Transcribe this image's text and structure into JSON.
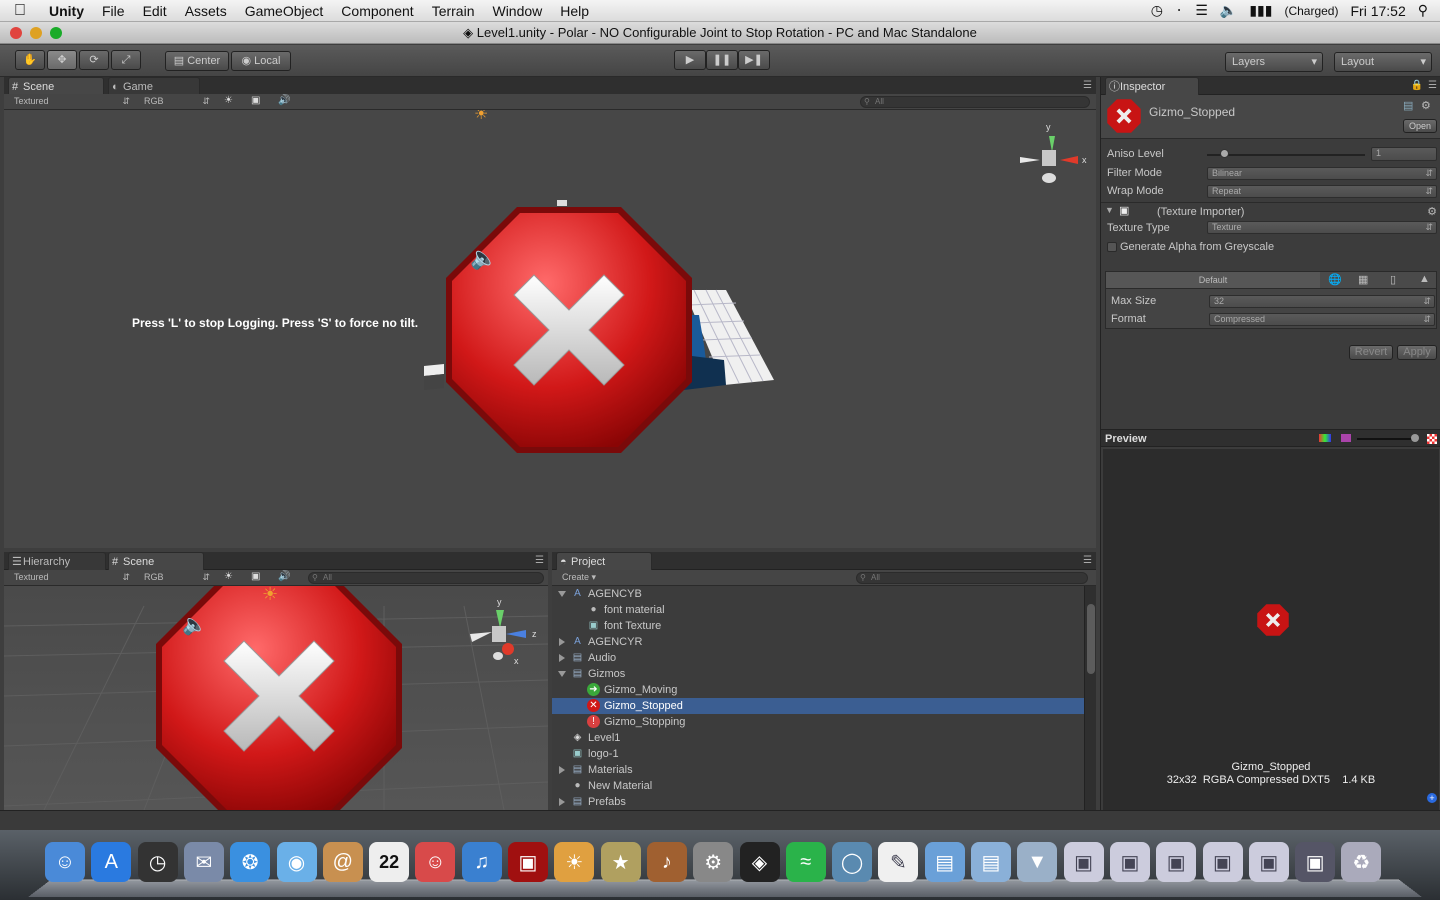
{
  "menubar": {
    "app": "Unity",
    "items": [
      "File",
      "Edit",
      "Assets",
      "GameObject",
      "Component",
      "Terrain",
      "Window",
      "Help"
    ],
    "battery": "(Charged)",
    "clock": "Fri 17:52"
  },
  "window": {
    "title": "Level1.unity - Polar - NO Configurable Joint to Stop Rotation - PC and Mac Standalone"
  },
  "toolbar": {
    "center_label": "Center",
    "local_label": "Local",
    "layers_label": "Layers",
    "layout_label": "Layout"
  },
  "scene_panel": {
    "tabs": [
      "Scene",
      "Game"
    ],
    "render_mode": "Textured",
    "color_mode": "RGB",
    "search_placeholder": "All",
    "overlay_text": "Press 'L' to stop Logging. Press 'S' to force no tilt."
  },
  "hierarchy_panel": {
    "tabs": [
      "Hierarchy",
      "Scene"
    ],
    "render_mode": "Textured",
    "color_mode": "RGB",
    "search_placeholder": "All"
  },
  "project_panel": {
    "tab": "Project",
    "create_label": "Create",
    "search_placeholder": "All",
    "rows": [
      {
        "label": "AGENCYB",
        "indent": 0,
        "expand": "open",
        "icon": "font-icon",
        "selected": false
      },
      {
        "label": "font material",
        "indent": 1,
        "expand": "none",
        "icon": "material-icon",
        "selected": false
      },
      {
        "label": "font Texture",
        "indent": 1,
        "expand": "none",
        "icon": "texture-icon",
        "selected": false
      },
      {
        "label": "AGENCYR",
        "indent": 0,
        "expand": "closed",
        "icon": "font-icon",
        "selected": false
      },
      {
        "label": "Audio",
        "indent": 0,
        "expand": "closed",
        "icon": "folder-icon",
        "selected": false
      },
      {
        "label": "Gizmos",
        "indent": 0,
        "expand": "open",
        "icon": "folder-icon",
        "selected": false
      },
      {
        "label": "Gizmo_Moving",
        "indent": 1,
        "expand": "none",
        "icon": "gizmo-moving-icon",
        "selected": false
      },
      {
        "label": "Gizmo_Stopped",
        "indent": 1,
        "expand": "none",
        "icon": "gizmo-stopped-icon",
        "selected": true
      },
      {
        "label": "Gizmo_Stopping",
        "indent": 1,
        "expand": "none",
        "icon": "gizmo-stopping-icon",
        "selected": false
      },
      {
        "label": "Level1",
        "indent": 0,
        "expand": "none",
        "icon": "unity-scene-icon",
        "selected": false
      },
      {
        "label": "logo-1",
        "indent": 0,
        "expand": "none",
        "icon": "texture-icon",
        "selected": false
      },
      {
        "label": "Materials",
        "indent": 0,
        "expand": "closed",
        "icon": "folder-icon",
        "selected": false
      },
      {
        "label": "New Material",
        "indent": 0,
        "expand": "none",
        "icon": "material-icon",
        "selected": false
      },
      {
        "label": "Prefabs",
        "indent": 0,
        "expand": "closed",
        "icon": "folder-icon",
        "selected": false
      }
    ]
  },
  "inspector": {
    "tab": "Inspector",
    "asset_name": "Gizmo_Stopped",
    "open_label": "Open",
    "aniso_label": "Aniso Level",
    "aniso_value": "1",
    "filter_label": "Filter Mode",
    "filter_value": "Bilinear",
    "wrap_label": "Wrap Mode",
    "wrap_value": "Repeat",
    "importer_label": "(Texture Importer)",
    "texture_type_label": "Texture Type",
    "texture_type_value": "Texture",
    "alpha_label": "Generate Alpha from Greyscale",
    "platform_default": "Default",
    "max_size_label": "Max Size",
    "max_size_value": "32",
    "format_label": "Format",
    "format_value": "Compressed",
    "revert_label": "Revert",
    "apply_label": "Apply",
    "preview_label": "Preview",
    "preview_name": "Gizmo_Stopped",
    "preview_info": "32x32  RGBA Compressed DXT5    1.4 KB"
  },
  "gizmo_axes": {
    "y": "y",
    "x": "x",
    "z": "z"
  },
  "dock": {
    "icons": [
      "finder-icon",
      "app-store-icon",
      "dashboard-icon",
      "mail-stamp-icon",
      "safari-icon",
      "facetime-icon",
      "contacts-icon",
      "calendar-icon",
      "photo-booth-icon",
      "itunes-icon",
      "dvd-player-icon",
      "iphoto-icon",
      "imovie-icon",
      "garageband-icon",
      "system-preferences-icon",
      "unity-icon",
      "spotify-icon",
      "network-icon",
      "textedit-icon",
      "applications-folder-icon",
      "documents-folder-icon",
      "downloads-icon",
      "window-1-icon",
      "window-2-icon",
      "window-3-icon",
      "window-4-icon",
      "window-5-icon",
      "window-6-icon",
      "trash-icon"
    ],
    "calendar_day": "22"
  }
}
